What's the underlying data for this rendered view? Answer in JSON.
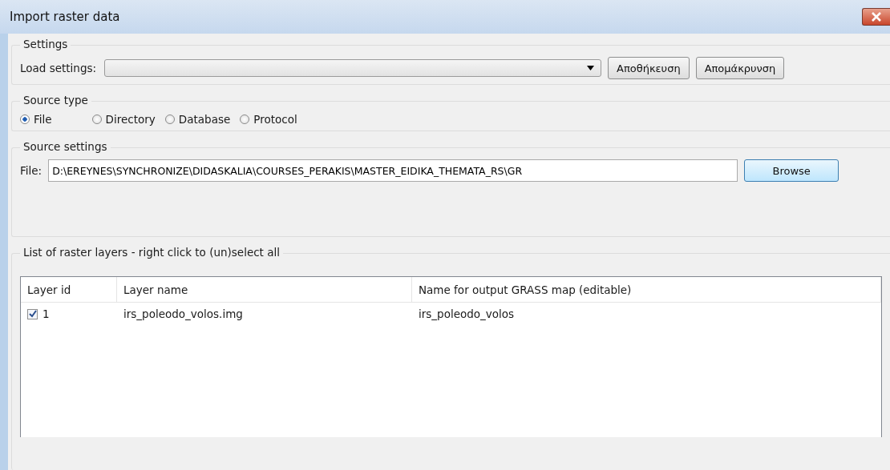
{
  "window": {
    "title": "Import raster data"
  },
  "settings": {
    "title": "Settings",
    "label": "Load settings:",
    "buttons": [
      "Αποθήκευση",
      "Απομάκρυνση"
    ]
  },
  "source_type": {
    "title": "Source type",
    "options": [
      {
        "label": "File",
        "selected": true
      },
      {
        "label": "Directory",
        "selected": false
      },
      {
        "label": "Database",
        "selected": false
      },
      {
        "label": "Protocol",
        "selected": false
      }
    ]
  },
  "source_settings": {
    "title": "Source settings",
    "label": "File:",
    "value": "D:\\EREYNES\\SYNCHRONIZE\\DIDASKALIA\\COURSES_PERAKIS\\MASTER_EIDIKA_THEMATA_RS\\GR",
    "button": "Browse"
  },
  "layers": {
    "title": "List of raster layers - right click to (un)select all",
    "columns": [
      "Layer id",
      "Layer name",
      "Name for output GRASS map (editable)"
    ],
    "rows": [
      {
        "checked": true,
        "cells": [
          "1",
          "irs_poleodo_volos.img",
          "irs_poleodo_volos"
        ]
      }
    ]
  }
}
